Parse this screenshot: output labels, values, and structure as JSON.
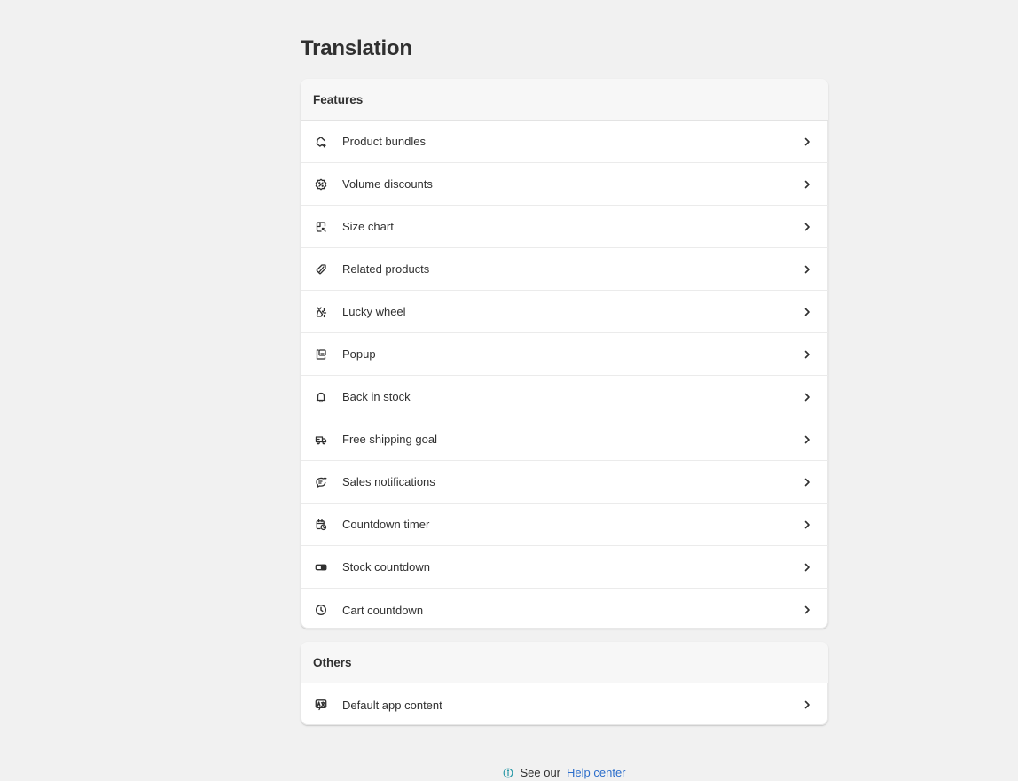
{
  "page": {
    "title": "Translation"
  },
  "features": {
    "header": "Features",
    "items": [
      {
        "label": "Product bundles",
        "icon": "bundle-icon"
      },
      {
        "label": "Volume discounts",
        "icon": "discount-badge-icon"
      },
      {
        "label": "Size chart",
        "icon": "size-chart-icon"
      },
      {
        "label": "Related products",
        "icon": "tag-icon"
      },
      {
        "label": "Lucky wheel",
        "icon": "wheel-icon"
      },
      {
        "label": "Popup",
        "icon": "popup-icon"
      },
      {
        "label": "Back in stock",
        "icon": "bell-icon"
      },
      {
        "label": "Free shipping goal",
        "icon": "truck-icon"
      },
      {
        "label": "Sales notifications",
        "icon": "chat-notification-icon"
      },
      {
        "label": "Countdown timer",
        "icon": "calendar-clock-icon"
      },
      {
        "label": "Stock countdown",
        "icon": "toggle-icon"
      },
      {
        "label": "Cart countdown",
        "icon": "clock-icon"
      }
    ]
  },
  "others": {
    "header": "Others",
    "items": [
      {
        "label": "Default app content",
        "icon": "language-icon"
      }
    ]
  },
  "footer": {
    "prefix": "See our",
    "link": "Help center",
    "link_color": "#2c6ecb"
  }
}
